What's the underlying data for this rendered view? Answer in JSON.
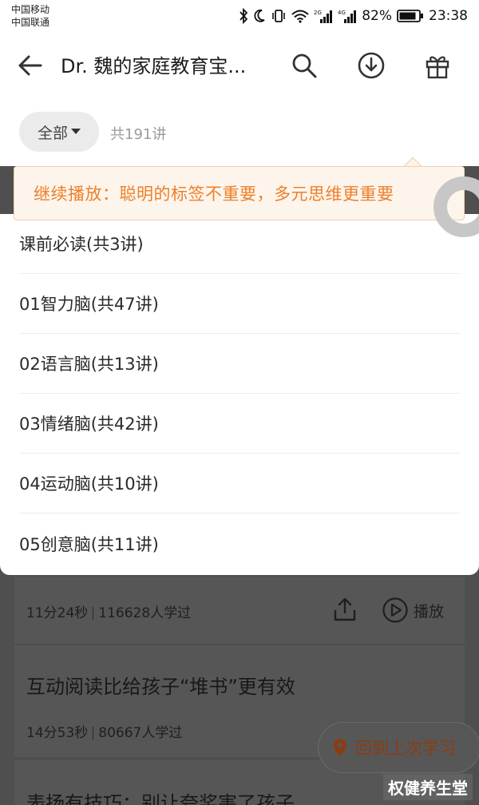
{
  "status_bar": {
    "carrier_1": "中国移动",
    "carrier_2": "中国联通",
    "signal_1_tag": "2G",
    "signal_2_tag": "4G",
    "battery": "82%",
    "time": "23:38"
  },
  "header": {
    "title": "Dr. 魏的家庭教育宝..."
  },
  "filter": {
    "selected": "全部",
    "count": "共191讲"
  },
  "tip": {
    "text": "继续播放：聪明的标签不重要，多元思维更重要"
  },
  "dropdown": {
    "items": [
      {
        "label": "课前必读(共3讲)"
      },
      {
        "label": "01智力脑(共47讲)"
      },
      {
        "label": "02语言脑(共13讲)"
      },
      {
        "label": "03情绪脑(共42讲)"
      },
      {
        "label": "04运动脑(共10讲)"
      },
      {
        "label": "05创意脑(共11讲)"
      }
    ]
  },
  "lessons": [
    {
      "duration": "11分24秒",
      "learners": "116628人学过",
      "play_label": "播放"
    },
    {
      "title": "互动阅读比给孩子“堆书”更有效",
      "duration": "14分53秒",
      "learners": "80667人学过"
    },
    {
      "title": "表扬有技巧：别让夸奖害了孩子"
    }
  ],
  "return_button": {
    "label": "回到上次学习"
  },
  "watermark": "权健养生堂",
  "colors": {
    "accent": "#ee7f2a",
    "overlay": "#4f4f4f",
    "return_text": "#8a3d12"
  }
}
